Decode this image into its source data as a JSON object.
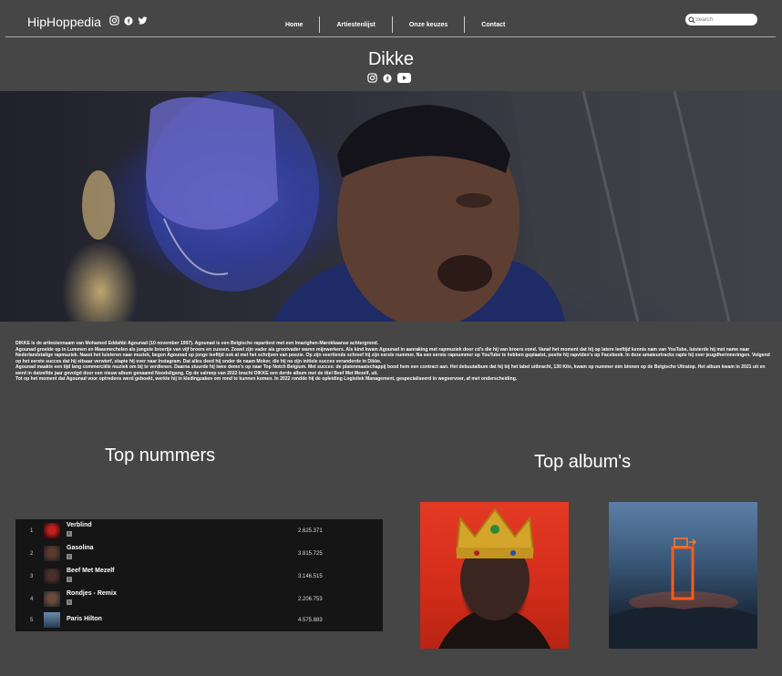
{
  "header": {
    "logo": "HipHoppedia",
    "social_icons": [
      "instagram-icon",
      "facebook-icon",
      "twitter-icon"
    ],
    "nav": [
      "Home",
      "Artiestenlijst",
      "Onze keuzes",
      "Contact"
    ],
    "search_placeholder": "Search"
  },
  "artist": {
    "name": "Dikke",
    "social_icons": [
      "instagram-icon",
      "facebook-icon",
      "youtube-icon"
    ]
  },
  "bio": [
    "DIKKE is de artiestennaam van Mohamed Eddahbi Agounad (10 november 1997). Agounad is een Belgische rapartiest met een Imazighen-Marokkaanse achtergrond.",
    "Agounad groeide op in Lummen en Maasmechelen als jongste broertje van vijf broers en zussen. Zowel zijn vader als grootvader waren mijnwerkers. Als kind kwam Agounad in aanraking met rapmuziek door cd's die hij van broers vond. Vanaf het moment dat hij op latere leeftijd kennis nam van YouTube, luisterde hij met name naar Nederlandstalige rapmuziek. Naast het luisteren naar muziek, begon Agounad op jonge leeftijd ook al met het schrijven van poezie. Op zijn veertiende schreef hij zijn eerste nummer. Na een eerste rapnummer op YouTube te hebben geplaatst, postte hij rapvideo's op Facebook. In deze amateurtracks rapte hij over jeugdherinneringen. Volgend op het eerste succes dat hij eitsaar verwierf, stapte hij over naar Instagram. Dat alles deed hij onder de naam Moker, die hij na zijn initiele succes veranderde in Dikke.",
    "Agounad maakte een tijd lang commerciële muziek om bij te verdienen. Daarna stuurde hij twee demo's op naar Top Notch Belgium. Met succes: de platenmaatschappij bood hem een contract aan. Het debuutalbum dat hij bij het label uitbracht, 130 Kilo, kwam op nummer één binnen op de Belgische Ultratop. Het album kwam in 2021 uit en werd in datzelfde jaar gevolgd door een nieuw album genaamd Noodsligang. Op de valreep van 2022 bracht DIKKE een derde album met de titel Beef Met Mezelf, uit.",
    "Tot op het moment dat Agounad voor optredens werd geboekt, werkte hij in kledingzaken om rond te kunnen komen. In 2022 rondde hij de opleiding Logistiek Management, gespecialiseerd in wegvervoer, af met onderscheiding."
  ],
  "top_tracks": {
    "title": "Top nummers",
    "tracks": [
      {
        "rank": "1",
        "name": "Verblind",
        "explicit": "E",
        "plays": "2.625.371"
      },
      {
        "rank": "2",
        "name": "Gasolina",
        "explicit": "E",
        "plays": "3.815.725"
      },
      {
        "rank": "3",
        "name": "Beef Met Mezelf",
        "explicit": "E",
        "plays": "3.146.515"
      },
      {
        "rank": "4",
        "name": "Rondjes - Remix",
        "explicit": "E",
        "plays": "2.206.753"
      },
      {
        "rank": "5",
        "name": "Paris Hilton",
        "explicit": "",
        "plays": "4.575.883"
      }
    ]
  },
  "top_albums": {
    "title": "Top album's"
  },
  "colors": {
    "background": "#464646",
    "player": "#151515"
  }
}
